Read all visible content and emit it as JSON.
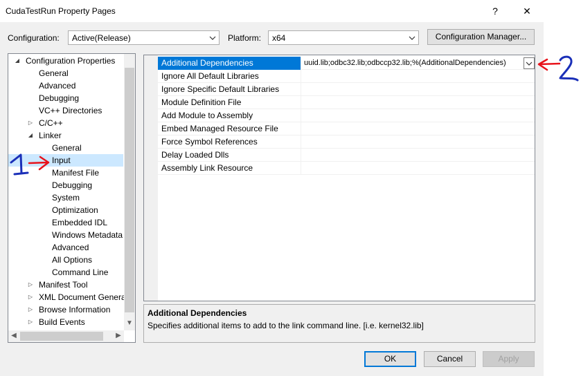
{
  "window": {
    "title": "CudaTestRun Property Pages",
    "help": "?",
    "close": "✕"
  },
  "config": {
    "label": "Configuration:",
    "value": "Active(Release)"
  },
  "platform": {
    "label": "Platform:",
    "value": "x64"
  },
  "config_manager": "Configuration Manager...",
  "tree": [
    {
      "label": "Configuration Properties",
      "exp": "open"
    },
    {
      "label": "General"
    },
    {
      "label": "Advanced"
    },
    {
      "label": "Debugging"
    },
    {
      "label": "VC++ Directories"
    },
    {
      "label": "C/C++",
      "exp": "closed"
    },
    {
      "label": "Linker",
      "exp": "open"
    },
    {
      "label": "General"
    },
    {
      "label": "Input",
      "selected": true
    },
    {
      "label": "Manifest File"
    },
    {
      "label": "Debugging"
    },
    {
      "label": "System"
    },
    {
      "label": "Optimization"
    },
    {
      "label": "Embedded IDL"
    },
    {
      "label": "Windows Metadata"
    },
    {
      "label": "Advanced"
    },
    {
      "label": "All Options"
    },
    {
      "label": "Command Line"
    },
    {
      "label": "Manifest Tool",
      "exp": "closed"
    },
    {
      "label": "XML Document Generator",
      "exp": "closed"
    },
    {
      "label": "Browse Information",
      "exp": "closed"
    },
    {
      "label": "Build Events",
      "exp": "closed"
    }
  ],
  "properties": [
    {
      "name": "Additional Dependencies",
      "value": "uuid.lib;odbc32.lib;odbccp32.lib;%(AdditionalDependencies)",
      "selected": true
    },
    {
      "name": "Ignore All Default Libraries",
      "value": ""
    },
    {
      "name": "Ignore Specific Default Libraries",
      "value": ""
    },
    {
      "name": "Module Definition File",
      "value": ""
    },
    {
      "name": "Add Module to Assembly",
      "value": ""
    },
    {
      "name": "Embed Managed Resource File",
      "value": ""
    },
    {
      "name": "Force Symbol References",
      "value": ""
    },
    {
      "name": "Delay Loaded Dlls",
      "value": ""
    },
    {
      "name": "Assembly Link Resource",
      "value": ""
    }
  ],
  "description": {
    "title": "Additional Dependencies",
    "text": "Specifies additional items to add to the link command line. [i.e. kernel32.lib]"
  },
  "buttons": {
    "ok": "OK",
    "cancel": "Cancel",
    "apply": "Apply"
  },
  "annotations": {
    "one": "1",
    "two": "2"
  },
  "colors": {
    "accent": "#0078d7",
    "selection": "#cce8ff",
    "annotation_red": "#e8131b",
    "annotation_blue": "#1a2fb8"
  }
}
